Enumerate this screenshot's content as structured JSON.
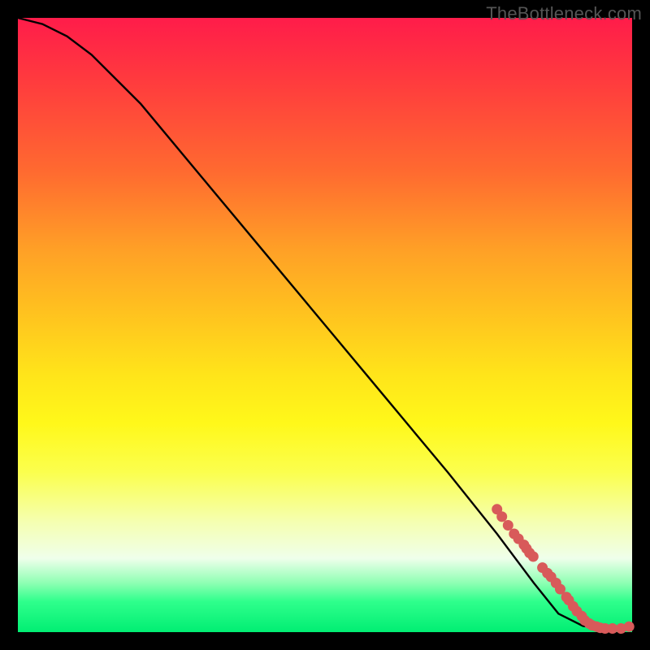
{
  "watermark": {
    "text": "TheBottleneck.com"
  },
  "chart_data": {
    "type": "line",
    "title": "",
    "xlabel": "",
    "ylabel": "",
    "xlim": [
      0,
      100
    ],
    "ylim": [
      0,
      100
    ],
    "series": [
      {
        "name": "curve",
        "x": [
          0,
          4,
          8,
          12,
          20,
          30,
          40,
          50,
          60,
          70,
          78,
          84,
          88,
          92,
          96,
          100
        ],
        "y": [
          100,
          99,
          97,
          94,
          86,
          74,
          62,
          50,
          38,
          26,
          16,
          8,
          3,
          1,
          0.5,
          0.5
        ]
      }
    ],
    "markers": [
      {
        "x": 78.0,
        "y": 20.0
      },
      {
        "x": 78.8,
        "y": 18.8
      },
      {
        "x": 79.8,
        "y": 17.4
      },
      {
        "x": 80.8,
        "y": 16.0
      },
      {
        "x": 81.5,
        "y": 15.2
      },
      {
        "x": 82.4,
        "y": 14.2
      },
      {
        "x": 82.8,
        "y": 13.6
      },
      {
        "x": 83.3,
        "y": 12.9
      },
      {
        "x": 83.9,
        "y": 12.3
      },
      {
        "x": 85.4,
        "y": 10.5
      },
      {
        "x": 86.2,
        "y": 9.6
      },
      {
        "x": 86.8,
        "y": 9.0
      },
      {
        "x": 87.6,
        "y": 8.0
      },
      {
        "x": 88.3,
        "y": 7.0
      },
      {
        "x": 89.3,
        "y": 5.7
      },
      {
        "x": 89.7,
        "y": 5.2
      },
      {
        "x": 90.4,
        "y": 4.2
      },
      {
        "x": 91.0,
        "y": 3.4
      },
      {
        "x": 91.8,
        "y": 2.6
      },
      {
        "x": 92.3,
        "y": 1.9
      },
      {
        "x": 93.0,
        "y": 1.4
      },
      {
        "x": 93.5,
        "y": 1.1
      },
      {
        "x": 94.2,
        "y": 0.9
      },
      {
        "x": 94.8,
        "y": 0.7
      },
      {
        "x": 95.6,
        "y": 0.6
      },
      {
        "x": 96.8,
        "y": 0.6
      },
      {
        "x": 98.2,
        "y": 0.6
      },
      {
        "x": 99.5,
        "y": 0.9
      }
    ],
    "colors": {
      "curve": "#000000",
      "marker_fill": "#d85a5a",
      "marker_stroke": "#b84444"
    }
  }
}
